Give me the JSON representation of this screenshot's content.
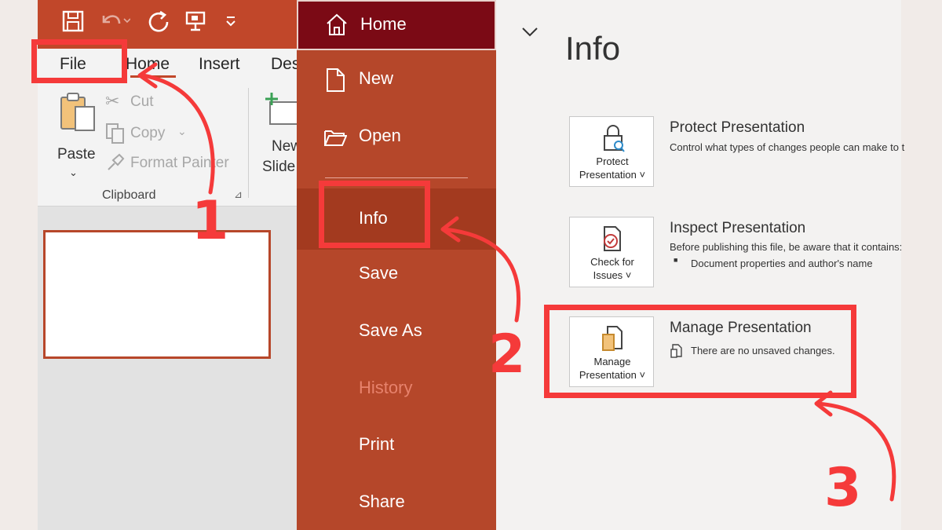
{
  "qat": {
    "icons": [
      "save-icon",
      "undo-icon",
      "redo-icon",
      "present-icon",
      "customize-qat-icon"
    ]
  },
  "ribbon_tabs": [
    "File",
    "Home",
    "Insert",
    "Des"
  ],
  "clipboard": {
    "paste_label": "Paste",
    "cut_label": "Cut",
    "copy_label": "Copy",
    "format_painter_label": "Format Painter",
    "group_label": "Clipboard"
  },
  "slides": {
    "new_label": "New",
    "slide_label": "Slide",
    "thumb_number": "1"
  },
  "backstage": {
    "items": [
      {
        "label": "Home",
        "icon": "home-icon"
      },
      {
        "label": "New",
        "icon": "new-document-icon"
      },
      {
        "label": "Open",
        "icon": "open-folder-icon"
      },
      {
        "label": "Info"
      },
      {
        "label": "Save"
      },
      {
        "label": "Save As"
      },
      {
        "label": "History",
        "disabled": true
      },
      {
        "label": "Print"
      },
      {
        "label": "Share"
      }
    ]
  },
  "info": {
    "title": "Info",
    "protect": {
      "button_line1": "Protect",
      "button_line2": "Presentation ˅",
      "title": "Protect Presentation",
      "desc": "Control what types of changes people can make to t"
    },
    "inspect": {
      "button_line1": "Check for",
      "button_line2": "Issues ˅",
      "title": "Inspect Presentation",
      "desc": "Before publishing this file, be aware that it contains:",
      "bullet": "Document properties and author's name"
    },
    "manage": {
      "button_line1": "Manage",
      "button_line2": "Presentation ˅",
      "title": "Manage Presentation",
      "desc": "There are no unsaved changes."
    }
  },
  "steps": [
    "1",
    "2",
    "3"
  ],
  "colors": {
    "accent": "#c1472a",
    "backstage": "#b5472a",
    "backstage_home": "#7b0a15",
    "annotation_red": "#f53a3a"
  }
}
